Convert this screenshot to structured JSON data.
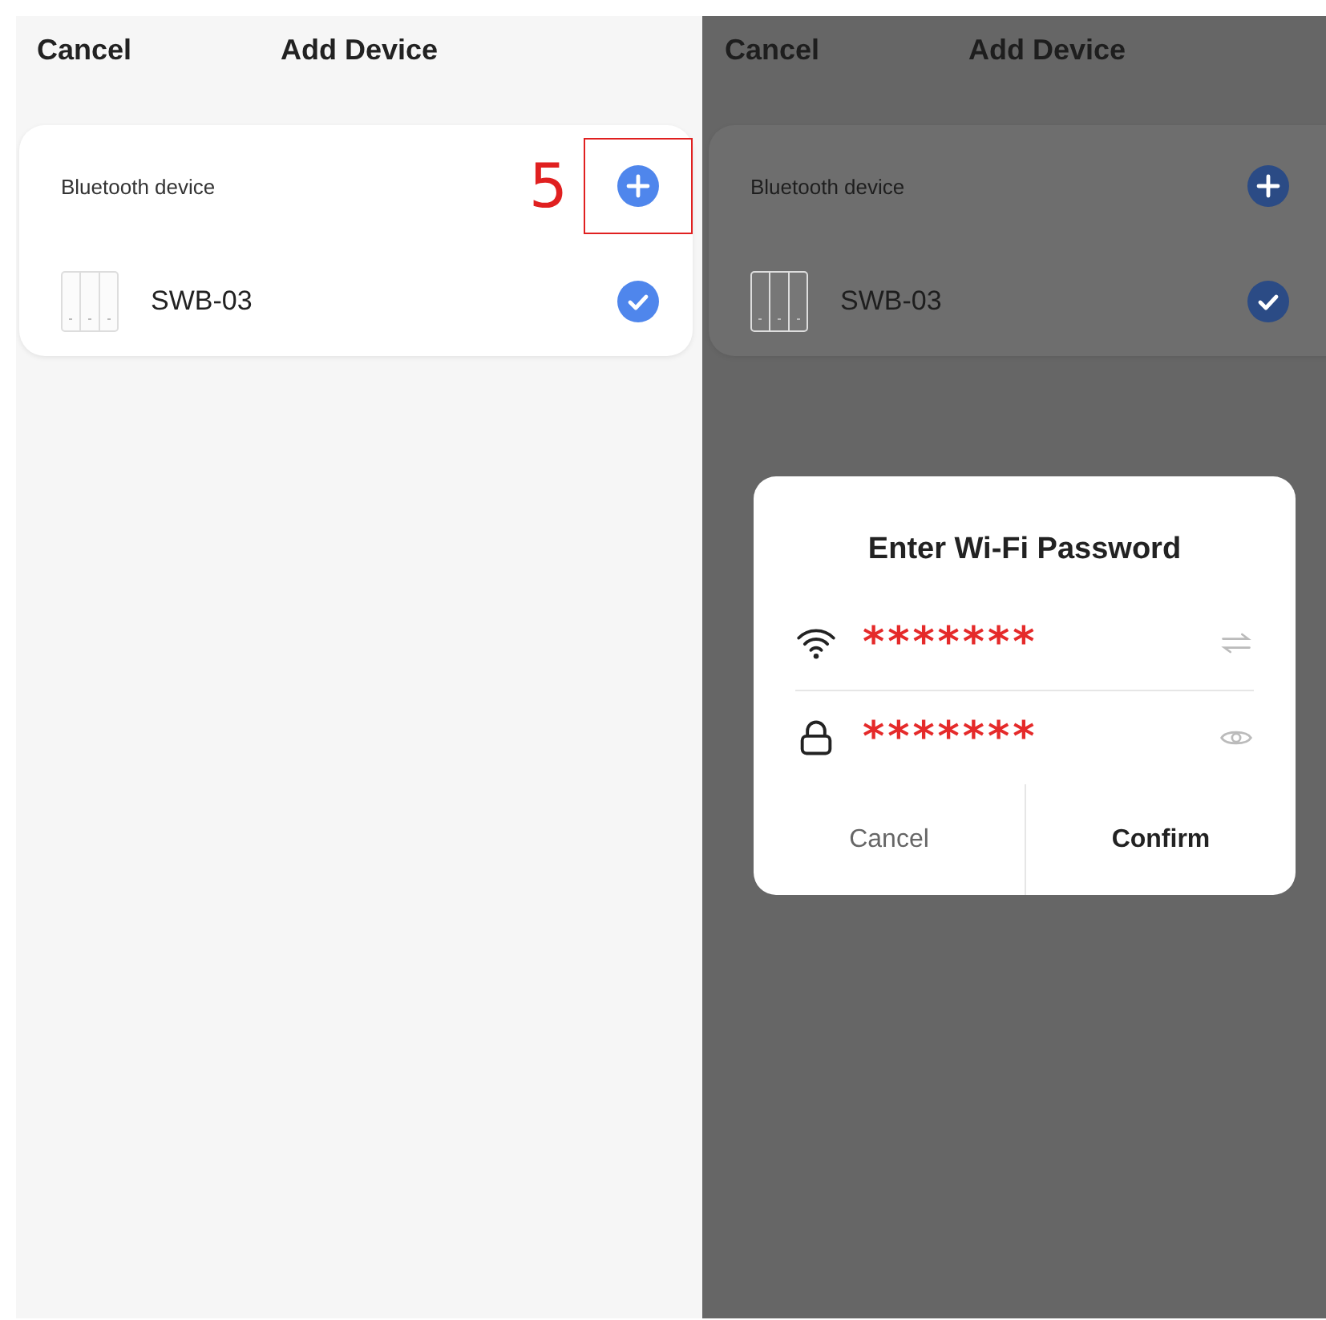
{
  "screens": [
    {
      "dimmed": false,
      "header": {
        "cancel": "Cancel",
        "title": "Add Device"
      },
      "card": {
        "section_label": "Bluetooth device",
        "device_name": "SWB-03",
        "device_checked": true
      },
      "annotation": {
        "number": "5"
      }
    },
    {
      "dimmed": true,
      "header": {
        "cancel": "Cancel",
        "title": "Add Device"
      },
      "card": {
        "section_label": "Bluetooth device",
        "device_name": "SWB-03",
        "device_checked": true
      },
      "dialog": {
        "title": "Enter Wi-Fi Password",
        "wifi_name": "*******",
        "password": "*******",
        "buttons": [
          {
            "label": "Cancel",
            "kind": "secondary"
          },
          {
            "label": "Confirm",
            "kind": "primary"
          }
        ]
      }
    }
  ]
}
